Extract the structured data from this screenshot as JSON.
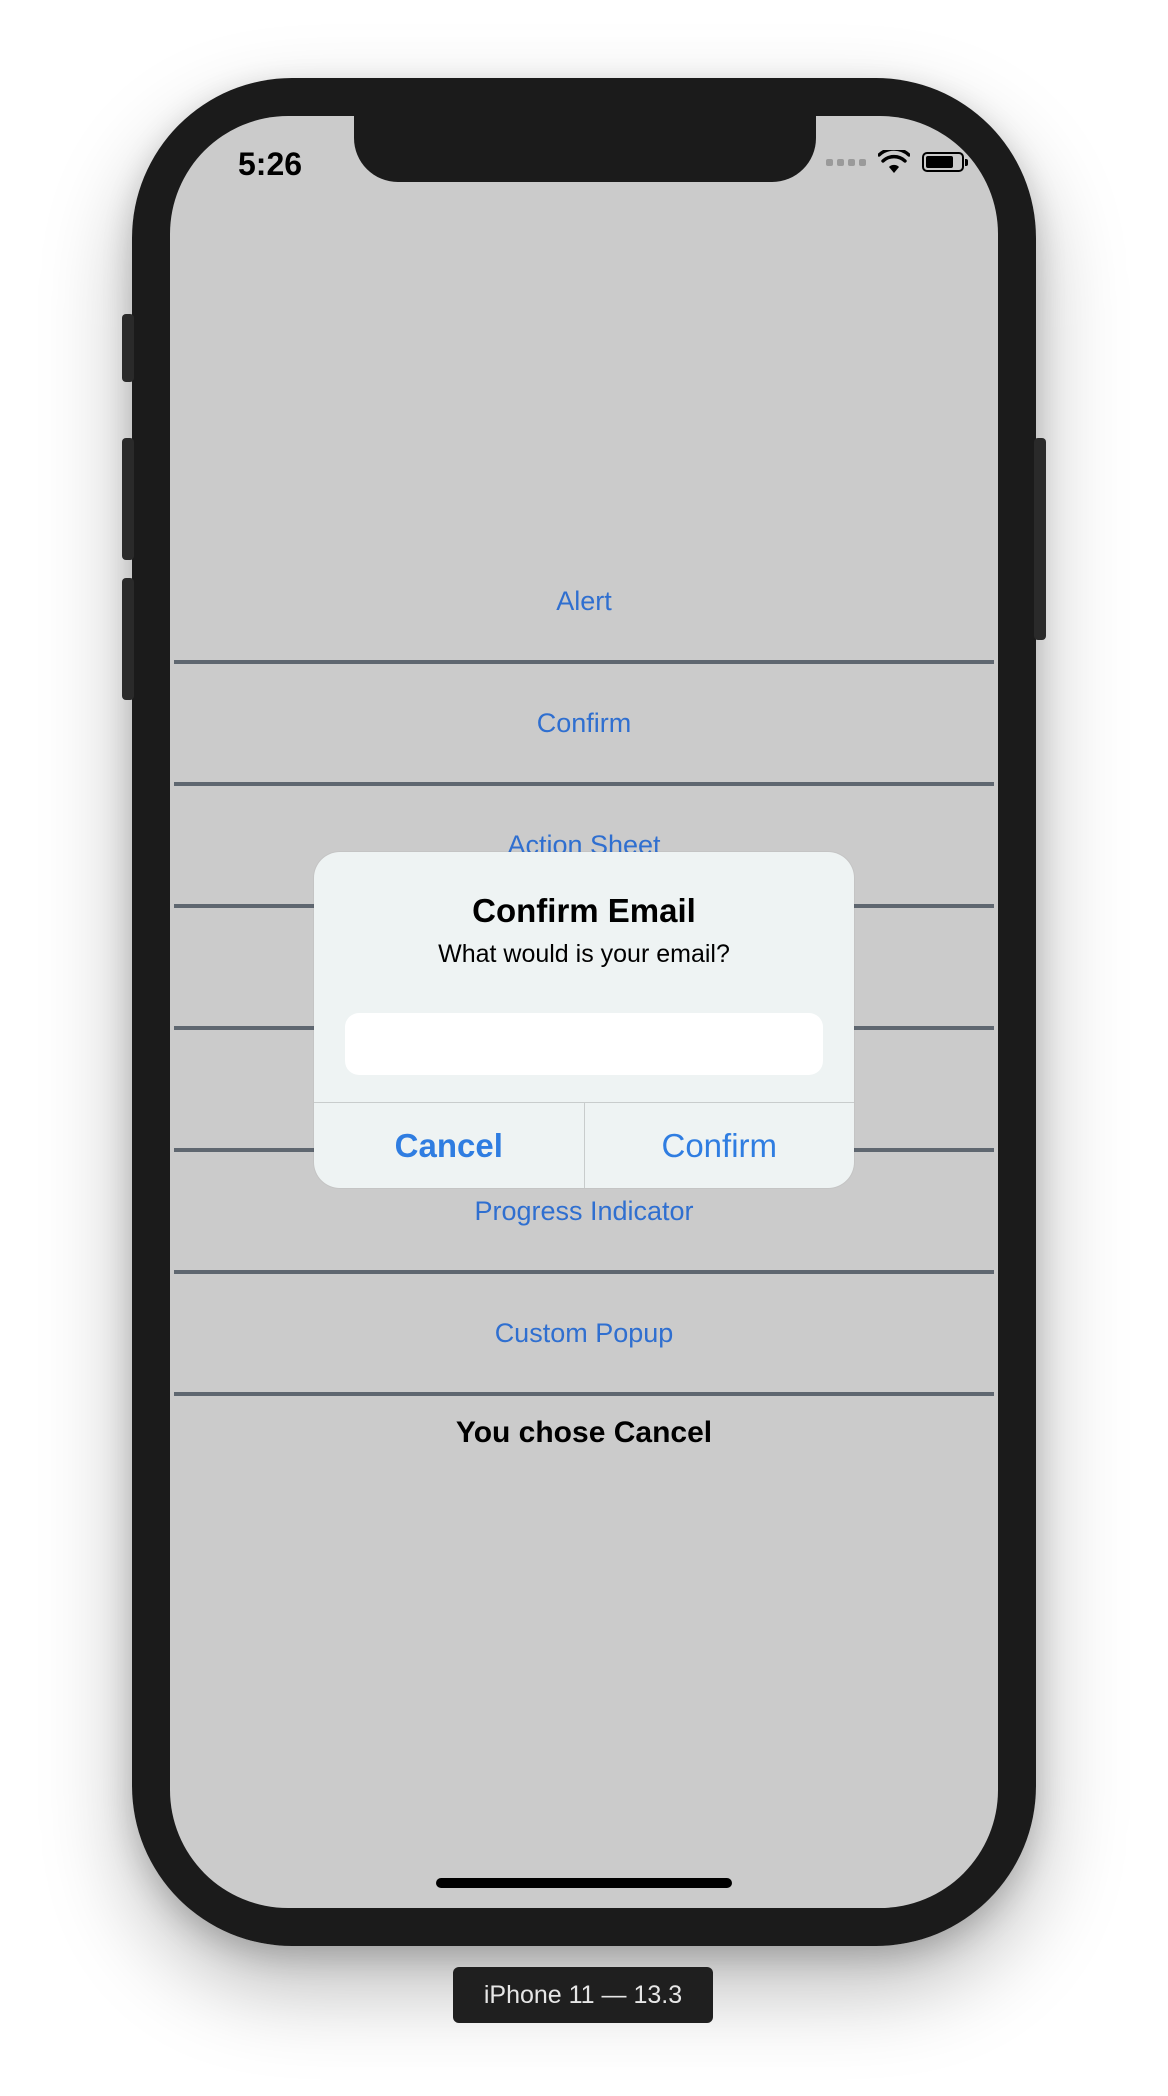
{
  "status_bar": {
    "time": "5:26",
    "battery_level": 0.8
  },
  "menu": {
    "items": [
      {
        "label": "Alert"
      },
      {
        "label": "Confirm"
      },
      {
        "label": "Action Sheet"
      },
      {
        "label": ""
      },
      {
        "label": ""
      },
      {
        "label": "Progress Indicator"
      },
      {
        "label": "Custom Popup"
      }
    ]
  },
  "result": {
    "text": "You chose Cancel"
  },
  "dialog": {
    "title": "Confirm Email",
    "message": "What would is your email?",
    "input_value": "",
    "cancel_label": "Cancel",
    "confirm_label": "Confirm"
  },
  "device": {
    "label": "iPhone 11 — 13.3"
  },
  "icons": {
    "signal": "signal-dots-icon",
    "wifi": "wifi-icon",
    "battery": "battery-icon"
  },
  "colors": {
    "accent": "#2f7de1",
    "link": "#2f6fd0",
    "screen_bg": "#cbcbcb",
    "frame": "#1b1b1b"
  }
}
